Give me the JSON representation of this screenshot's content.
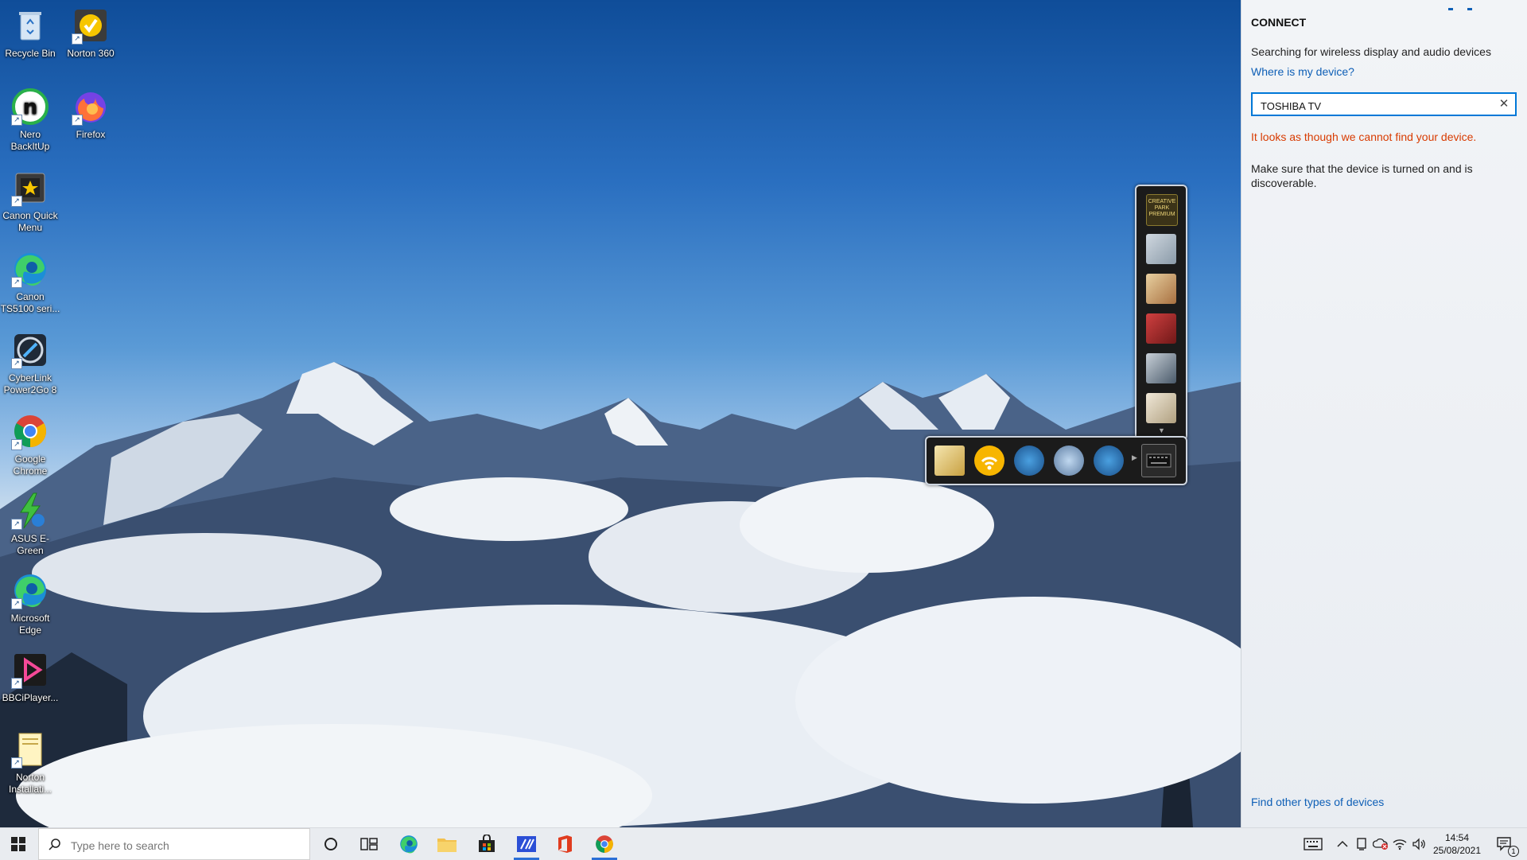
{
  "desktop": {
    "icons": [
      {
        "label": "Recycle Bin"
      },
      {
        "label": "Norton 360"
      },
      {
        "label": "Nero BackItUp"
      },
      {
        "label": "Firefox"
      },
      {
        "label": "Canon Quick Menu"
      },
      {
        "label": "Canon TS5100 seri..."
      },
      {
        "label": "CyberLink Power2Go 8"
      },
      {
        "label": "Google Chrome"
      },
      {
        "label": "ASUS E-Green"
      },
      {
        "label": "Microsoft Edge"
      },
      {
        "label": "BBCiPlayer..."
      },
      {
        "label": "Norton Installati..."
      }
    ]
  },
  "canon_toolbar": {
    "badge_text": "CREATIVE PARK PREMIUM"
  },
  "connect": {
    "title": "CONNECT",
    "searching_text": "Searching for wireless display and audio devices",
    "where_link": "Where is my device?",
    "input_value": "TOSHIBA TV",
    "clear_label": "✕",
    "error_text": "It looks as though we cannot find your device.",
    "hint_text": "Make sure that the device is turned on and is discoverable.",
    "find_other_link": "Find other types of devices"
  },
  "taskbar": {
    "search_placeholder": "Type here to search",
    "clock_time": "14:54",
    "clock_date": "25/08/2021",
    "notification_count": "1"
  },
  "colors": {
    "accent": "#0078d7",
    "link": "#0e5fb6",
    "error": "#d83b01"
  }
}
